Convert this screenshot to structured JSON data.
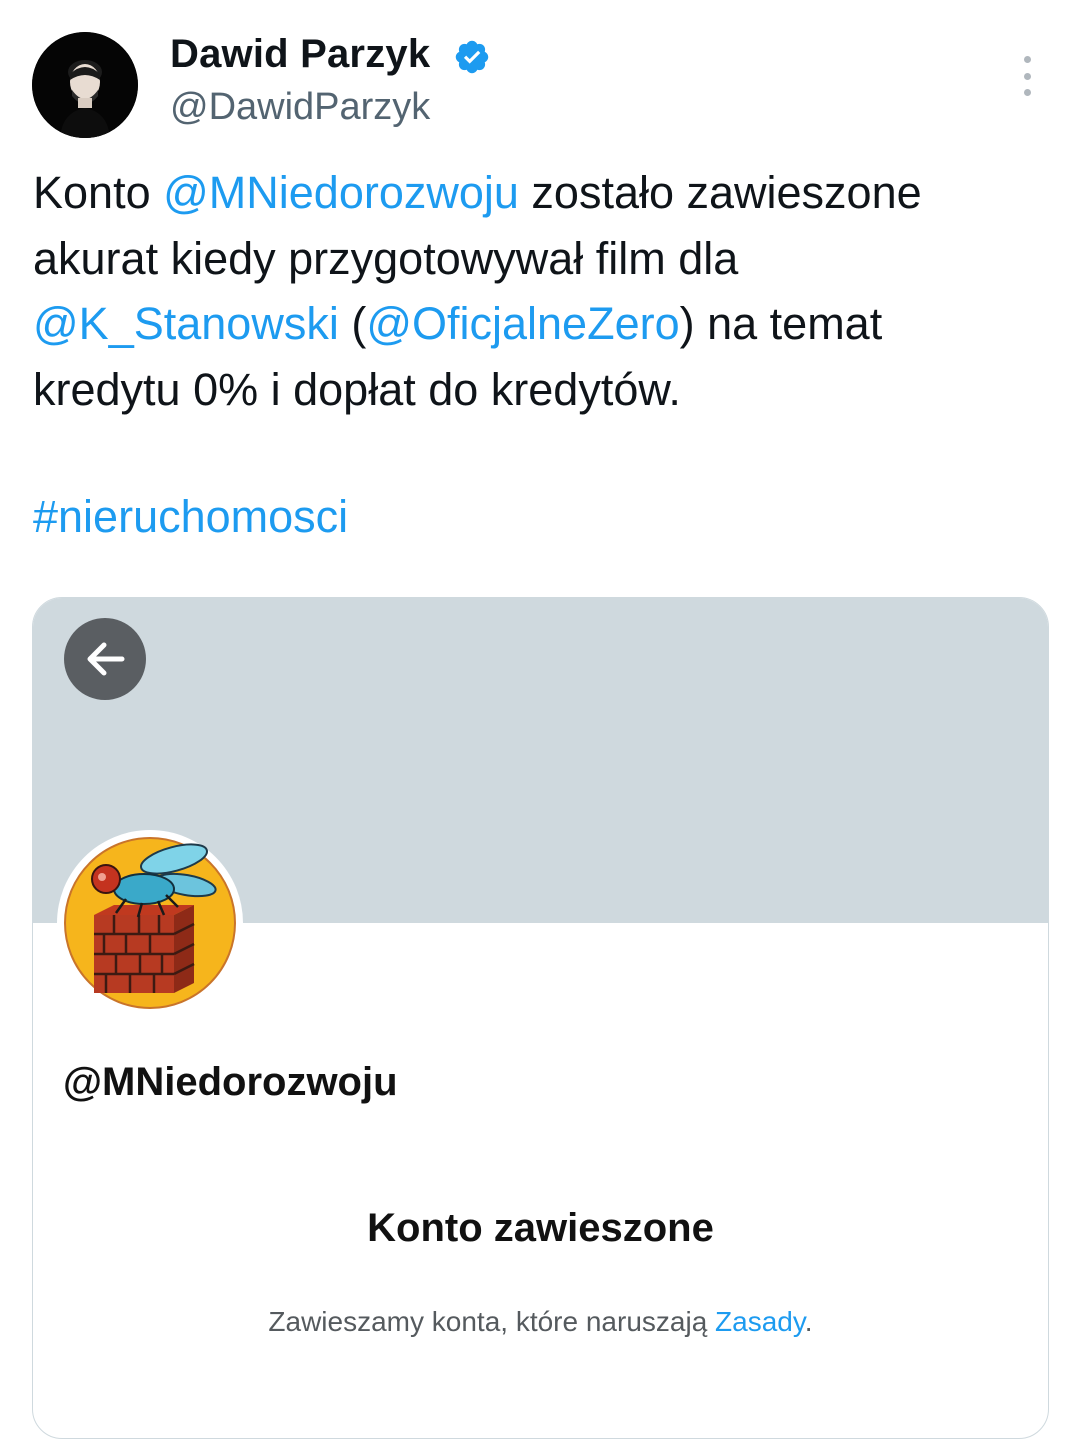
{
  "author": {
    "display_name": "Dawid Parzyk",
    "handle": "@DawidParzyk"
  },
  "tweet": {
    "line1": {
      "pre": "Konto ",
      "mention": "@MNiedorozwoju",
      "post": " zostało zawieszone"
    },
    "line2": "akurat kiedy przygotowywał film dla",
    "line3": {
      "mention1": "@K_Stanowski",
      "mid1": " (",
      "mention2": "@OficjalneZero",
      "post": ") na temat"
    },
    "line4": "kredytu 0% i dopłat do kredytów.",
    "hashtag": "#nieruchomosci"
  },
  "card": {
    "handle": "@MNiedorozwoju",
    "title": "Konto zawieszone",
    "desc_pre": "Zawieszamy konta, które naruszają ",
    "desc_link": "Zasady",
    "desc_post": "."
  },
  "colors": {
    "link": "#1d9bf0",
    "text": "#0f1419",
    "secondary": "#536471",
    "banner": "#cfd9de"
  },
  "icons": [
    "verified-badge-icon",
    "more-options-icon",
    "back-arrow-icon"
  ]
}
